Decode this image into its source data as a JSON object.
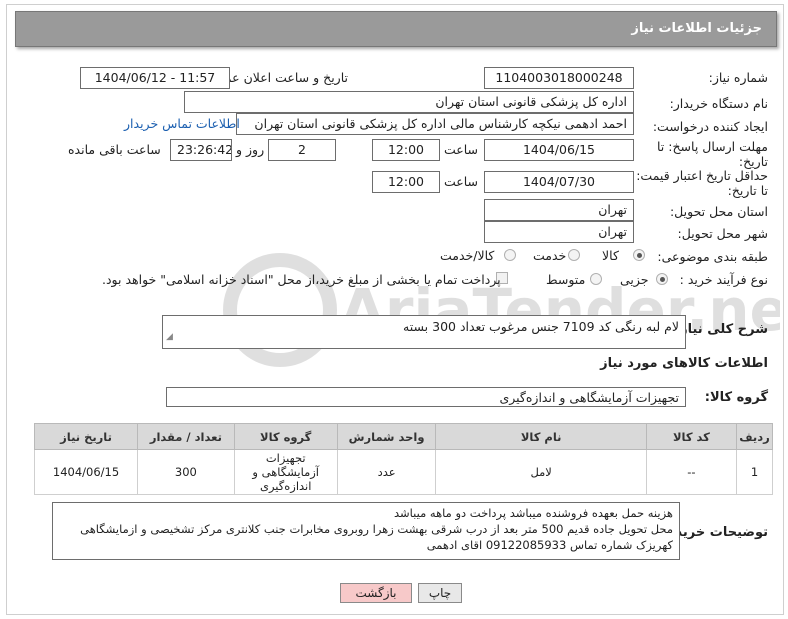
{
  "header": {
    "title": "جزئیات اطلاعات نیاز"
  },
  "fields": {
    "need_number_label": "شماره نیاز:",
    "need_number": "1104003018000248",
    "announce_label": "تاریخ و ساعت اعلان عمومی:",
    "announce_value": "1404/06/12 - 11:57",
    "buyer_org_label": "نام دستگاه خریدار:",
    "buyer_org": "اداره کل پزشکی قانونی استان تهران",
    "creator_label": "ایجاد کننده درخواست:",
    "creator": "احمد ادهمی نیکچه کارشناس مالی اداره کل پزشکی قانونی استان تهران",
    "contact_link": "اطلاعات تماس خریدار",
    "deadline_label": "مهلت ارسال پاسخ: تا تاریخ:",
    "deadline_date": "1404/06/15",
    "time_label": "ساعت",
    "deadline_time": "12:00",
    "days": "2",
    "days_label": "روز و",
    "remaining_time": "23:26:42",
    "remaining_label": "ساعت باقی مانده",
    "validity_label": "حداقل تاریخ اعتبار قیمت: تا تاریخ:",
    "validity_date": "1404/07/30",
    "validity_time": "12:00",
    "province_label": "استان محل تحویل:",
    "province": "تهران",
    "city_label": "شهر محل تحویل:",
    "city": "تهران",
    "category_label": "طبقه بندی موضوعی:",
    "category_options": [
      "کالا",
      "خدمت",
      "کالا/خدمت"
    ],
    "process_label": "نوع فرآیند خرید :",
    "process_options": [
      "جزیی",
      "متوسط"
    ],
    "payment_note": "پرداخت تمام یا بخشی از مبلغ خرید،از محل \"اسناد خزانه اسلامی\" خواهد بود."
  },
  "description": {
    "label": "شرح کلی نیاز:",
    "text": "لام لبه رنگی کد 7109 جنس مرغوب تعداد 300 بسته"
  },
  "goods": {
    "section_title": "اطلاعات کالاهای مورد نیاز",
    "group_label": "گروه کالا:",
    "group_value": "تجهیزات آزمایشگاهی و اندازه‌گیری",
    "columns": [
      "ردیف",
      "کد کالا",
      "نام کالا",
      "واحد شمارش",
      "گروه کالا",
      "تعداد / مقدار",
      "تاریخ نیاز"
    ],
    "rows": [
      {
        "row": "1",
        "code": "--",
        "name": "لامل",
        "unit": "عدد",
        "group": "تجهیزات آزمایشگاهی و اندازه‌گیری",
        "qty": "300",
        "date": "1404/06/15"
      }
    ]
  },
  "buyer_notes": {
    "label": "توضیحات خریدار:",
    "line1": "هزینه حمل بعهده فروشنده میباشد پرداخت دو ماهه میباشد",
    "line2": "محل تحویل جاده قدیم 500 متر بعد از درب شرقی بهشت زهرا روبروی مخابرات جنب کلانتری مرکز تشخیصی و ازمایشگاهی",
    "line3": "کهریزک شماره تماس 09122085933 اقای ادهمی"
  },
  "buttons": {
    "print": "چاپ",
    "back": "بازگشت"
  },
  "watermark": {
    "text": "AriaTender.neT"
  },
  "colors": {
    "header_bg": "#9a9a9a",
    "back_btn": "#f7c9c9",
    "print_btn": "#e8e8e8",
    "link": "#1b5fb0"
  }
}
